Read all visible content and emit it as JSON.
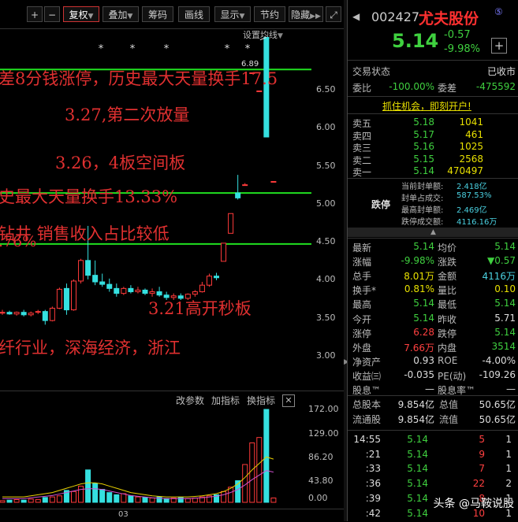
{
  "toolbar": {
    "plus": "+",
    "minus": "−",
    "fuquan": "复权",
    "diejia": "叠加",
    "chouma": "筹码",
    "huaxian": "画线",
    "xianshi": "显示",
    "jieyue": "节约",
    "yincang": "隐藏",
    "expand": "⤢",
    "settings_ma": "设置均线"
  },
  "chart": {
    "y_ticks": [
      "6.50",
      "6.00",
      "5.50",
      "5.00",
      "4.50",
      "4.00",
      "3.50",
      "3.00"
    ],
    "top_price": "6.89",
    "annotations": [
      "差8分钱涨停，历史最大天量换手17.5",
      "3.27,第二次放量",
      "3.26，4板空间板",
      "史最大天量换手13.33%",
      "钻井 销售收入占比较低",
      ".76%",
      "3.21高开秒板",
      "纤行业，深海经济，浙江"
    ],
    "date_label": "03",
    "vol_buttons": [
      "改参数",
      "加指标",
      "换指标"
    ],
    "vol_ticks": [
      "172.00",
      "129.00",
      "86.20",
      "43.80",
      "0.00"
    ],
    "colors": {
      "up": "#ff3a3a",
      "down": "#35e0e0",
      "ma": "#ffffff",
      "green_line": "#20e020"
    }
  },
  "chart_data": {
    "type": "candlestick",
    "ylim": [
      2.6,
      7.0
    ],
    "candles": [
      {
        "o": 3.54,
        "h": 3.58,
        "l": 3.52,
        "c": 3.55
      },
      {
        "o": 3.55,
        "h": 3.57,
        "l": 3.52,
        "c": 3.53
      },
      {
        "o": 3.53,
        "h": 3.56,
        "l": 3.51,
        "c": 3.55
      },
      {
        "o": 3.55,
        "h": 3.58,
        "l": 3.5,
        "c": 3.52
      },
      {
        "o": 3.52,
        "h": 3.56,
        "l": 3.5,
        "c": 3.54
      },
      {
        "o": 3.55,
        "h": 3.58,
        "l": 3.53,
        "c": 3.56
      },
      {
        "o": 3.56,
        "h": 3.58,
        "l": 3.4,
        "c": 3.45
      },
      {
        "o": 3.45,
        "h": 3.62,
        "l": 3.44,
        "c": 3.6
      },
      {
        "o": 3.6,
        "h": 3.85,
        "l": 3.59,
        "c": 3.83
      },
      {
        "o": 3.84,
        "h": 3.9,
        "l": 3.52,
        "c": 3.58
      },
      {
        "o": 3.58,
        "h": 3.95,
        "l": 3.57,
        "c": 3.93
      },
      {
        "o": 3.93,
        "h": 4.2,
        "l": 3.9,
        "c": 4.18
      },
      {
        "o": 4.18,
        "h": 4.6,
        "l": 3.95,
        "c": 4.0
      },
      {
        "o": 4.0,
        "h": 4.18,
        "l": 3.88,
        "c": 3.92
      },
      {
        "o": 3.92,
        "h": 4.02,
        "l": 3.86,
        "c": 3.89
      },
      {
        "o": 3.89,
        "h": 3.96,
        "l": 3.8,
        "c": 3.84
      },
      {
        "o": 3.84,
        "h": 3.9,
        "l": 3.74,
        "c": 3.78
      },
      {
        "o": 3.78,
        "h": 3.86,
        "l": 3.76,
        "c": 3.84
      },
      {
        "o": 3.84,
        "h": 3.88,
        "l": 3.78,
        "c": 3.8
      },
      {
        "o": 3.8,
        "h": 3.86,
        "l": 3.78,
        "c": 3.82
      },
      {
        "o": 3.82,
        "h": 3.84,
        "l": 3.76,
        "c": 3.78
      },
      {
        "o": 3.78,
        "h": 3.84,
        "l": 3.74,
        "c": 3.8
      },
      {
        "o": 3.8,
        "h": 3.86,
        "l": 3.74,
        "c": 3.76
      },
      {
        "o": 3.76,
        "h": 3.8,
        "l": 3.7,
        "c": 3.73
      },
      {
        "o": 3.73,
        "h": 3.78,
        "l": 3.7,
        "c": 3.75
      },
      {
        "o": 3.75,
        "h": 3.78,
        "l": 3.7,
        "c": 3.72
      },
      {
        "o": 3.72,
        "h": 3.78,
        "l": 3.7,
        "c": 3.77
      },
      {
        "o": 3.77,
        "h": 3.82,
        "l": 3.74,
        "c": 3.8
      },
      {
        "o": 3.8,
        "h": 3.92,
        "l": 3.79,
        "c": 3.88
      },
      {
        "o": 3.88,
        "h": 4.02,
        "l": 3.86,
        "c": 3.99
      },
      {
        "o": 3.99,
        "h": 4.03,
        "l": 3.94,
        "c": 3.97
      },
      {
        "o": 4.17,
        "h": 4.39,
        "l": 4.17,
        "c": 4.39
      },
      {
        "o": 4.51,
        "h": 4.75,
        "l": 4.51,
        "c": 4.75
      },
      {
        "o": 5.0,
        "h": 5.22,
        "l": 4.92,
        "c": 4.94
      },
      {
        "o": 5.1,
        "h": 5.12,
        "l": 5.1,
        "c": 5.1
      },
      {
        "o": 6.46,
        "h": 6.46,
        "l": 6.46,
        "c": 6.46
      },
      {
        "o": 6.24,
        "h": 6.24,
        "l": 6.24,
        "c": 6.24
      },
      {
        "o": 6.89,
        "h": 6.89,
        "l": 5.68,
        "c": 5.68
      },
      {
        "o": 5.14,
        "h": 5.14,
        "l": 5.14,
        "c": 5.14
      }
    ],
    "hlines": [
      6.5,
      5.0,
      4.38
    ],
    "volumes": [
      3,
      4,
      5,
      4,
      6,
      5,
      9,
      10,
      12,
      22,
      20,
      30,
      60,
      35,
      24,
      18,
      14,
      16,
      12,
      10,
      9,
      8,
      10,
      7,
      8,
      9,
      7,
      8,
      10,
      12,
      14,
      20,
      28,
      40,
      70,
      110,
      120,
      172,
      8
    ],
    "vol_ma": [
      10,
      10,
      10,
      10,
      12,
      14,
      16,
      18,
      22,
      26,
      30,
      34,
      36,
      36,
      34,
      30,
      26,
      22,
      18,
      16,
      14,
      12,
      11,
      10,
      10,
      10,
      10,
      11,
      12,
      14,
      16,
      20,
      26,
      34,
      46,
      60,
      72,
      84,
      80
    ]
  },
  "panel": {
    "code": "002427",
    "name": "尤夫股份",
    "badge": "⑤",
    "price": "5.14",
    "change": "-0.57",
    "pct": "-9.98%",
    "plus": "+",
    "status_label": "交易状态",
    "status_val": "已收市",
    "weibi_label": "委比",
    "weibi_val": "-100.00%",
    "weicha_label": "委差",
    "weicha_val": "-475592",
    "ad": "抓住机会，即刻开户!",
    "asks": [
      {
        "l": "卖五",
        "p": "5.18",
        "v": "1041"
      },
      {
        "l": "卖四",
        "p": "5.17",
        "v": "461"
      },
      {
        "l": "卖三",
        "p": "5.16",
        "v": "1025"
      },
      {
        "l": "卖二",
        "p": "5.15",
        "v": "2568"
      },
      {
        "l": "卖一",
        "p": "5.14",
        "v": "470497"
      }
    ],
    "limit_label": "跌停",
    "limit_rows": [
      {
        "l": "当前封单额:",
        "v": "2.418亿"
      },
      {
        "l": "封单占成交:",
        "v": "587.53%"
      },
      {
        "l": "最高封单额:",
        "v": "2.469亿"
      },
      {
        "l": "跌停成交额:",
        "v": "4116.16万"
      }
    ],
    "stats": [
      {
        "l1": "最新",
        "v1": "5.14",
        "c1": "g",
        "l2": "均价",
        "v2": "5.14",
        "c2": "g"
      },
      {
        "l1": "涨幅",
        "v1": "-9.98%",
        "c1": "g",
        "l2": "涨跌",
        "v2": "▼0.57",
        "c2": "g"
      },
      {
        "l1": "总手",
        "v1": "8.01万",
        "c1": "y",
        "l2": "金额",
        "v2": "4116万",
        "c2": "c"
      },
      {
        "l1": "换手*",
        "v1": "0.81%",
        "c1": "y",
        "l2": "量比",
        "v2": "0.10",
        "c2": "y"
      },
      {
        "l1": "最高",
        "v1": "5.14",
        "c1": "g",
        "l2": "最低",
        "v2": "5.14",
        "c2": "g"
      },
      {
        "l1": "今开",
        "v1": "5.14",
        "c1": "g",
        "l2": "昨收",
        "v2": "5.71",
        "c2": "w"
      },
      {
        "l1": "涨停",
        "v1": "6.28",
        "c1": "r",
        "l2": "跌停",
        "v2": "5.14",
        "c2": "g"
      },
      {
        "l1": "外盘",
        "v1": "7.66万",
        "c1": "r",
        "l2": "内盘",
        "v2": "3514",
        "c2": "g"
      },
      {
        "l1": "净资产",
        "v1": "0.93",
        "c1": "w",
        "l2": "ROE",
        "v2": "-4.00%",
        "c2": "w"
      },
      {
        "l1": "收益㈢",
        "v1": "-0.035",
        "c1": "w",
        "l2": "PE(动)",
        "v2": "-109.26",
        "c2": "w"
      },
      {
        "l1": "股息™",
        "v1": "—",
        "c1": "w",
        "l2": "股息率™",
        "v2": "—",
        "c2": "w"
      }
    ],
    "caps": [
      {
        "l1": "总股本",
        "v1": "9.854亿",
        "l2": "总值",
        "v2": "50.65亿"
      },
      {
        "l1": "流通股",
        "v1": "9.854亿",
        "l2": "流值",
        "v2": "50.65亿"
      }
    ],
    "ticks": [
      {
        "t": "14:55",
        "p": "5.14",
        "v": "5",
        "n": "1"
      },
      {
        "t": ":21",
        "p": "5.14",
        "v": "9",
        "n": "1"
      },
      {
        "t": ":33",
        "p": "5.14",
        "v": "7",
        "n": "1"
      },
      {
        "t": ":36",
        "p": "5.14",
        "v": "22",
        "n": "2"
      },
      {
        "t": ":39",
        "p": "5.14",
        "v": "8",
        "n": "1"
      },
      {
        "t": ":42",
        "p": "5.14",
        "v": "10",
        "n": "1"
      }
    ],
    "watermark": "头条 @马鞍说股"
  }
}
